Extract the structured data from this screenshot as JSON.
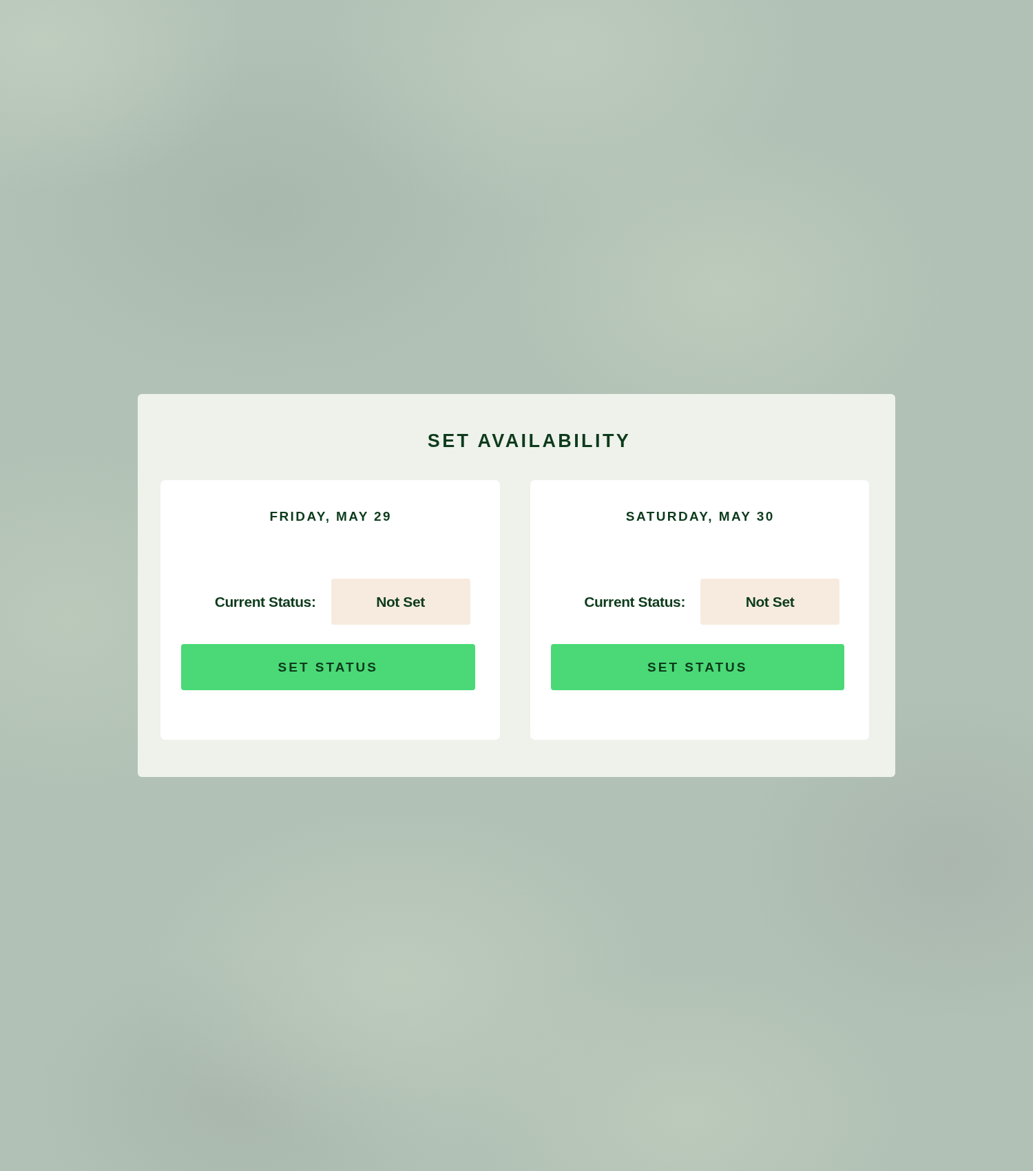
{
  "panel": {
    "title": "SET AVAILABILITY",
    "days": [
      {
        "date": "FRIDAY, MAY 29",
        "status_label": "Current Status:",
        "status": "Not Set",
        "button": "SET STATUS"
      },
      {
        "date": "SATURDAY, MAY 30",
        "status_label": "Current Status:",
        "status": "Not Set",
        "button": "SET STATUS"
      }
    ]
  }
}
